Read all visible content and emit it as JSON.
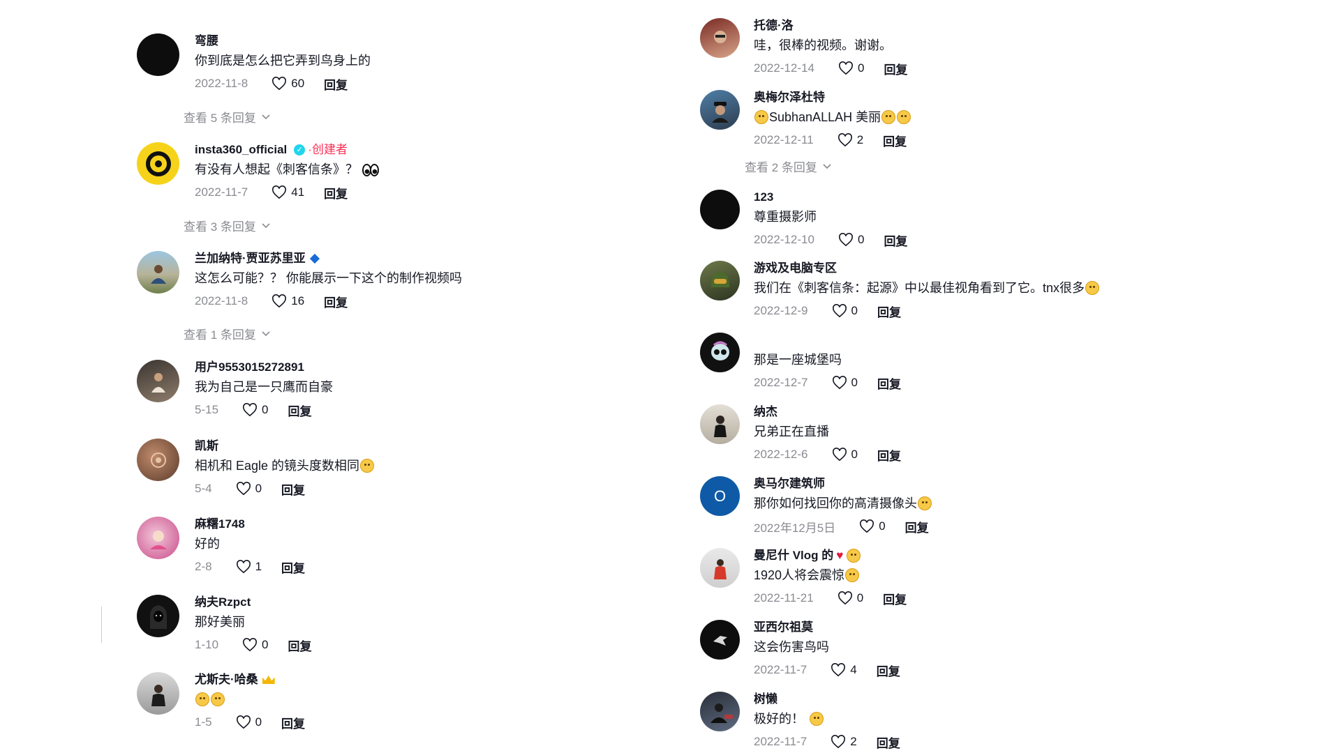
{
  "labels": {
    "reply": "回复"
  },
  "left": [
    {
      "user": "弯腰",
      "text": "你到底是怎么把它弄到鸟身上的",
      "date": "2022-11-8",
      "likes": "60",
      "avatar": "black-circle",
      "view_replies": "查看 5 条回复"
    },
    {
      "user": "insta360_official",
      "verified": true,
      "badge": "·创建者",
      "text": "有没有人想起《刺客信条》？",
      "date": "2022-11-7",
      "likes": "41",
      "avatar": "insta360-logo",
      "view_replies": "查看 3 条回复"
    },
    {
      "user": "兰加纳特·贾亚苏里亚",
      "text": "这怎么可能？？ 你能展示一下这个的制作视频吗",
      "date": "2022-11-8",
      "likes": "16",
      "avatar": "photo-person-outdoor",
      "view_replies": "查看 1 条回复"
    },
    {
      "user": "用户9553015272891",
      "text": "我为自己是一只鹰而自豪",
      "date": "5-15",
      "likes": "0",
      "avatar": "photo-person-dark"
    },
    {
      "user": "凯斯",
      "text": "相机和 Eagle 的镜头度数相同",
      "date": "5-4",
      "likes": "0",
      "avatar": "photo-brown"
    },
    {
      "user": "麻糬1748",
      "text": "好的",
      "date": "2-8",
      "likes": "1",
      "avatar": "photo-pink"
    },
    {
      "user": "纳夫Rzpct",
      "text": "那好美丽",
      "date": "1-10",
      "likes": "0",
      "avatar": "photo-hooded"
    },
    {
      "user": "尤斯夫·哈桑",
      "text": "",
      "date": "1-5",
      "likes": "0",
      "avatar": "photo-person-suit"
    }
  ],
  "right": [
    {
      "user": "托德·洛",
      "text": "哇，很棒的视频。谢谢。",
      "date": "2022-12-14",
      "likes": "0",
      "avatar": "photo-man-face"
    },
    {
      "user": "奥梅尔泽杜特",
      "text": "SubhanALLAH 美丽",
      "date": "2022-12-11",
      "likes": "2",
      "avatar": "photo-man-cap",
      "view_replies": "查看 2 条回复"
    },
    {
      "user": "123",
      "text": "尊重摄影师",
      "date": "2022-12-10",
      "likes": "0",
      "avatar": "black-circle"
    },
    {
      "user": "游戏及电脑专区",
      "text": "我们在《刺客信条：起源》中以最佳视角看到了它。tnx很多",
      "date": "2022-12-9",
      "likes": "0",
      "avatar": "photo-helmet"
    },
    {
      "user": "",
      "text": "那是一座城堡吗",
      "date": "2022-12-7",
      "likes": "0",
      "avatar": "skull-avatar"
    },
    {
      "user": "纳杰",
      "text": "兄弟正在直播",
      "date": "2022-12-6",
      "likes": "0",
      "avatar": "photo-person-light"
    },
    {
      "user": "奥马尔建筑师",
      "text": "那你如何找回你的高清摄像头",
      "date": "2022年12月5日",
      "likes": "0",
      "avatar": "letter-o",
      "avatar_letter": "O"
    },
    {
      "user": "曼尼什 Vlog 的",
      "text": "1920人将会震惊",
      "date": "2022-11-21",
      "likes": "0",
      "avatar": "photo-red-jacket"
    },
    {
      "user": "亚西尔祖莫",
      "text": "这会伤害鸟吗",
      "date": "2022-11-7",
      "likes": "4",
      "avatar": "photo-black-bird"
    },
    {
      "user": "树懒",
      "text": "极好的！",
      "date": "2022-11-7",
      "likes": "2",
      "avatar": "photo-dark-car"
    }
  ]
}
